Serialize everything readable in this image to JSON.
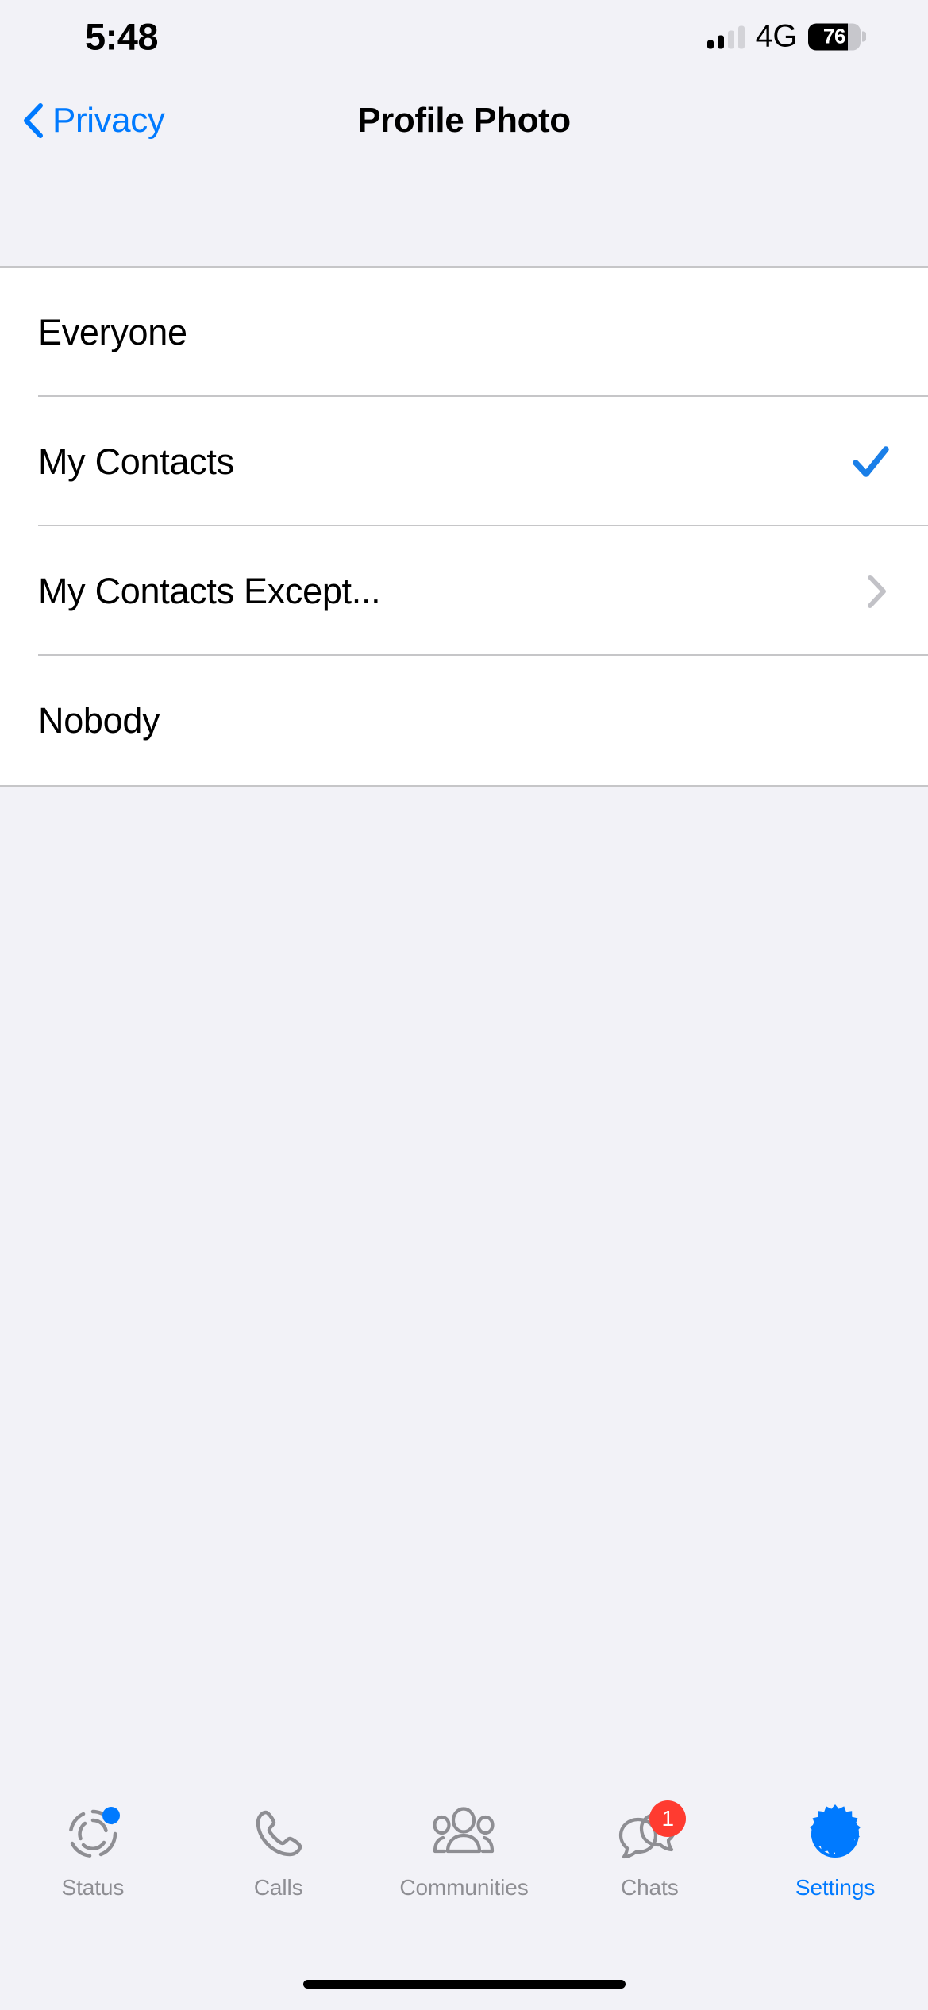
{
  "status_bar": {
    "time": "5:48",
    "network": "4G",
    "battery_percent": "76",
    "battery_level": 76,
    "signal_bars_active": 2,
    "signal_bars_total": 4
  },
  "nav": {
    "back_label": "Privacy",
    "back_icon": "chevron-left-icon",
    "title": "Profile Photo"
  },
  "colors": {
    "accent": "#007AFF",
    "badge": "#FF3B30",
    "inactive": "#8E8E93",
    "separator": "#C6C6C8",
    "page_background": "#F2F2F7",
    "row_background": "#FFFFFF"
  },
  "options": [
    {
      "label": "Everyone",
      "selected": false,
      "accessory": "none"
    },
    {
      "label": "My Contacts",
      "selected": true,
      "accessory": "checkmark"
    },
    {
      "label": "My Contacts Except...",
      "selected": false,
      "accessory": "chevron"
    },
    {
      "label": "Nobody",
      "selected": false,
      "accessory": "none"
    }
  ],
  "tabs": [
    {
      "label": "Status",
      "icon": "status-rings-icon",
      "active": false,
      "badge": "",
      "dot": true
    },
    {
      "label": "Calls",
      "icon": "phone-icon",
      "active": false,
      "badge": "",
      "dot": false
    },
    {
      "label": "Communities",
      "icon": "communities-people-icon",
      "active": false,
      "badge": "",
      "dot": false
    },
    {
      "label": "Chats",
      "icon": "chat-bubbles-icon",
      "active": false,
      "badge": "1",
      "dot": false
    },
    {
      "label": "Settings",
      "icon": "gear-icon",
      "active": true,
      "badge": "",
      "dot": false
    }
  ]
}
